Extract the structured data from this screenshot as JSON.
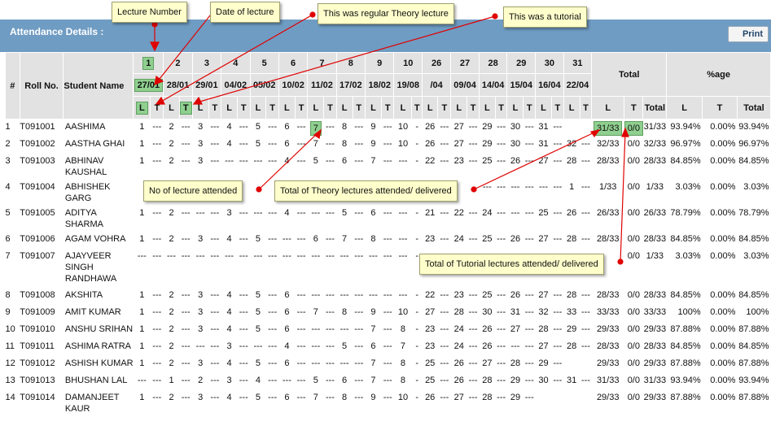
{
  "header": {
    "title": "Attendance Details :",
    "print_label": "Print"
  },
  "columns": {
    "hash": "#",
    "roll": "Roll No.",
    "name": "Student Name",
    "lectures": [
      {
        "no": "1",
        "date": "27/01",
        "type": "L"
      },
      {
        "no": "",
        "date": "",
        "type": "T"
      },
      {
        "no": "2",
        "date": "28/01",
        "type": "L"
      },
      {
        "no": "",
        "date": "",
        "type": "T"
      },
      {
        "no": "3",
        "date": "29/01",
        "type": "L"
      },
      {
        "no": "",
        "date": "",
        "type": "T"
      },
      {
        "no": "4",
        "date": "04/02",
        "type": "L"
      },
      {
        "no": "",
        "date": "",
        "type": "T"
      },
      {
        "no": "5",
        "date": "05/02",
        "type": "L"
      },
      {
        "no": "",
        "date": "",
        "type": "T"
      },
      {
        "no": "6",
        "date": "10/02",
        "type": "L"
      },
      {
        "no": "",
        "date": "",
        "type": "T"
      },
      {
        "no": "7",
        "date": "11/02",
        "type": "L"
      },
      {
        "no": "",
        "date": "",
        "type": "T"
      },
      {
        "no": "8",
        "date": "17/02",
        "type": "L"
      },
      {
        "no": "",
        "date": "",
        "type": "T"
      },
      {
        "no": "9",
        "date": "18/02",
        "type": "L"
      },
      {
        "no": "",
        "date": "",
        "type": "T"
      },
      {
        "no": "10",
        "date": "19/08",
        "type": "L"
      },
      {
        "no": "",
        "date": "",
        "type": "T"
      },
      {
        "no": "26",
        "date": "/04",
        "type": "L"
      },
      {
        "no": "",
        "date": "",
        "type": "T"
      },
      {
        "no": "27",
        "date": "09/04",
        "type": "L"
      },
      {
        "no": "",
        "date": "",
        "type": "T"
      },
      {
        "no": "28",
        "date": "14/04",
        "type": "L"
      },
      {
        "no": "",
        "date": "",
        "type": "T"
      },
      {
        "no": "29",
        "date": "15/04",
        "type": "L"
      },
      {
        "no": "",
        "date": "",
        "type": "T"
      },
      {
        "no": "30",
        "date": "16/04",
        "type": "L"
      },
      {
        "no": "",
        "date": "",
        "type": "T"
      },
      {
        "no": "31",
        "date": "22/04",
        "type": "L"
      },
      {
        "no": "",
        "date": "",
        "type": "T"
      }
    ],
    "total_group": "Total",
    "pct_group": "%age",
    "total_sub": [
      "L",
      "T",
      "Total"
    ],
    "pct_sub": [
      "L",
      "T",
      "Total"
    ]
  },
  "rows": [
    {
      "idx": "1",
      "roll": "T091001",
      "name": "AASHIMA",
      "cells": [
        "1",
        "---",
        "2",
        "---",
        "3",
        "---",
        "4",
        "---",
        "5",
        "---",
        "6",
        "---",
        "7",
        "---",
        "8",
        "---",
        "9",
        "---",
        "10",
        "-",
        "26",
        "---",
        "27",
        "---",
        "29",
        "---",
        "30",
        "---",
        "31",
        "---",
        "",
        ""
      ],
      "tl": "31/33",
      "tt": "0/0",
      "tot": "31/33",
      "pl": "93.94%",
      "pt": "0.00%",
      "ptot": "93.94%"
    },
    {
      "idx": "2",
      "roll": "T091002",
      "name": "AASTHA GHAI",
      "cells": [
        "1",
        "---",
        "2",
        "---",
        "3",
        "---",
        "4",
        "---",
        "5",
        "---",
        "6",
        "---",
        "7",
        "---",
        "8",
        "---",
        "9",
        "---",
        "10",
        "-",
        "26",
        "---",
        "27",
        "---",
        "29",
        "---",
        "30",
        "---",
        "31",
        "---",
        "32",
        "---"
      ],
      "tl": "32/33",
      "tt": "0/0",
      "tot": "32/33",
      "pl": "96.97%",
      "pt": "0.00%",
      "ptot": "96.97%"
    },
    {
      "idx": "3",
      "roll": "T091003",
      "name": "ABHINAV KAUSHAL",
      "cells": [
        "1",
        "---",
        "2",
        "---",
        "3",
        "---",
        "---",
        "---",
        "---",
        "---",
        "4",
        "---",
        "5",
        "---",
        "6",
        "---",
        "7",
        "---",
        "---",
        "-",
        "22",
        "---",
        "23",
        "---",
        "25",
        "---",
        "26",
        "---",
        "27",
        "---",
        "28",
        "---"
      ],
      "tl": "28/33",
      "tt": "0/0",
      "tot": "28/33",
      "pl": "84.85%",
      "pt": "0.00%",
      "ptot": "84.85%"
    },
    {
      "idx": "4",
      "roll": "T091004",
      "name": "ABHISHEK GARG",
      "cells": [
        "",
        "",
        "",
        "",
        "",
        "",
        "",
        "",
        "",
        "",
        "",
        "",
        "",
        "",
        "",
        "",
        "",
        "",
        "",
        "",
        "",
        "",
        "",
        "",
        "---",
        "---",
        "---",
        "---",
        "---",
        "---",
        "1",
        "---"
      ],
      "tl": "1/33",
      "tt": "0/0",
      "tot": "1/33",
      "pl": "3.03%",
      "pt": "0.00%",
      "ptot": "3.03%"
    },
    {
      "idx": "5",
      "roll": "T091005",
      "name": "ADITYA SHARMA",
      "cells": [
        "1",
        "---",
        "2",
        "---",
        "---",
        "---",
        "3",
        "---",
        "---",
        "---",
        "4",
        "---",
        "---",
        "---",
        "5",
        "---",
        "6",
        "---",
        "---",
        "-",
        "21",
        "---",
        "22",
        "---",
        "24",
        "---",
        "---",
        "---",
        "25",
        "---",
        "26",
        "---"
      ],
      "tl": "26/33",
      "tt": "0/0",
      "tot": "26/33",
      "pl": "78.79%",
      "pt": "0.00%",
      "ptot": "78.79%"
    },
    {
      "idx": "6",
      "roll": "T091006",
      "name": "AGAM VOHRA",
      "cells": [
        "1",
        "---",
        "2",
        "---",
        "3",
        "---",
        "4",
        "---",
        "5",
        "---",
        "---",
        "---",
        "6",
        "---",
        "7",
        "---",
        "8",
        "---",
        "---",
        "-",
        "23",
        "---",
        "24",
        "---",
        "25",
        "---",
        "26",
        "---",
        "27",
        "---",
        "28",
        "---"
      ],
      "tl": "28/33",
      "tt": "0/0",
      "tot": "28/33",
      "pl": "84.85%",
      "pt": "0.00%",
      "ptot": "84.85%"
    },
    {
      "idx": "7",
      "roll": "T091007",
      "name": "AJAYVEER SINGH RANDHAWA",
      "cells": [
        "---",
        "---",
        "---",
        "---",
        "---",
        "---",
        "---",
        "---",
        "---",
        "---",
        "---",
        "---",
        "---",
        "---",
        "---",
        "---",
        "---",
        "---",
        "---",
        "-",
        "",
        "",
        "",
        "",
        "",
        "",
        "",
        "",
        "",
        "",
        "",
        ""
      ],
      "tl": "",
      "tt": "0/0",
      "tot": "1/33",
      "pl": "3.03%",
      "pt": "0.00%",
      "ptot": "3.03%"
    },
    {
      "idx": "8",
      "roll": "T091008",
      "name": "AKSHITA",
      "cells": [
        "1",
        "---",
        "2",
        "---",
        "3",
        "---",
        "4",
        "---",
        "5",
        "---",
        "6",
        "---",
        "---",
        "---",
        "---",
        "---",
        "---",
        "---",
        "---",
        "-",
        "22",
        "---",
        "23",
        "---",
        "25",
        "---",
        "26",
        "---",
        "27",
        "---",
        "28",
        "---"
      ],
      "tl": "28/33",
      "tt": "0/0",
      "tot": "28/33",
      "pl": "84.85%",
      "pt": "0.00%",
      "ptot": "84.85%"
    },
    {
      "idx": "9",
      "roll": "T091009",
      "name": "AMIT KUMAR",
      "cells": [
        "1",
        "---",
        "2",
        "---",
        "3",
        "---",
        "4",
        "---",
        "5",
        "---",
        "6",
        "---",
        "7",
        "---",
        "8",
        "---",
        "9",
        "---",
        "10",
        "-",
        "27",
        "---",
        "28",
        "---",
        "30",
        "---",
        "31",
        "---",
        "32",
        "---",
        "33",
        "---"
      ],
      "tl": "33/33",
      "tt": "0/0",
      "tot": "33/33",
      "pl": "100%",
      "pt": "0.00%",
      "ptot": "100%"
    },
    {
      "idx": "10",
      "roll": "T091010",
      "name": "ANSHU SRIHAN",
      "cells": [
        "1",
        "---",
        "2",
        "---",
        "3",
        "---",
        "4",
        "---",
        "5",
        "---",
        "6",
        "---",
        "---",
        "---",
        "---",
        "---",
        "7",
        "---",
        "8",
        "-",
        "23",
        "---",
        "24",
        "---",
        "26",
        "---",
        "27",
        "---",
        "28",
        "---",
        "29",
        "---"
      ],
      "tl": "29/33",
      "tt": "0/0",
      "tot": "29/33",
      "pl": "87.88%",
      "pt": "0.00%",
      "ptot": "87.88%"
    },
    {
      "idx": "11",
      "roll": "T091011",
      "name": "ASHIMA RATRA",
      "cells": [
        "1",
        "---",
        "2",
        "---",
        "---",
        "---",
        "3",
        "---",
        "---",
        "---",
        "4",
        "---",
        "---",
        "---",
        "5",
        "---",
        "6",
        "---",
        "7",
        "-",
        "23",
        "---",
        "24",
        "---",
        "26",
        "---",
        "---",
        "---",
        "27",
        "---",
        "28",
        "---"
      ],
      "tl": "28/33",
      "tt": "0/0",
      "tot": "28/33",
      "pl": "84.85%",
      "pt": "0.00%",
      "ptot": "84.85%"
    },
    {
      "idx": "12",
      "roll": "T091012",
      "name": "ASHISH KUMAR",
      "cells": [
        "1",
        "---",
        "2",
        "---",
        "3",
        "---",
        "4",
        "---",
        "5",
        "---",
        "6",
        "---",
        "---",
        "---",
        "---",
        "---",
        "7",
        "---",
        "8",
        "-",
        "25",
        "---",
        "26",
        "---",
        "27",
        "---",
        "28",
        "---",
        "29",
        "---",
        "",
        ""
      ],
      "tl": "29/33",
      "tt": "0/0",
      "tot": "29/33",
      "pl": "87.88%",
      "pt": "0.00%",
      "ptot": "87.88%"
    },
    {
      "idx": "13",
      "roll": "T091013",
      "name": "BHUSHAN LAL",
      "cells": [
        "---",
        "---",
        "1",
        "---",
        "2",
        "---",
        "3",
        "---",
        "4",
        "---",
        "---",
        "---",
        "5",
        "---",
        "6",
        "---",
        "7",
        "---",
        "8",
        "-",
        "25",
        "---",
        "26",
        "---",
        "28",
        "---",
        "29",
        "---",
        "30",
        "---",
        "31",
        "---"
      ],
      "tl": "31/33",
      "tt": "0/0",
      "tot": "31/33",
      "pl": "93.94%",
      "pt": "0.00%",
      "ptot": "93.94%"
    },
    {
      "idx": "14",
      "roll": "T091014",
      "name": "DAMANJEET KAUR",
      "cells": [
        "1",
        "---",
        "2",
        "---",
        "3",
        "---",
        "4",
        "---",
        "5",
        "---",
        "6",
        "---",
        "7",
        "---",
        "8",
        "---",
        "9",
        "---",
        "10",
        "-",
        "26",
        "---",
        "27",
        "---",
        "28",
        "---",
        "29",
        "---",
        "",
        "",
        " ",
        ""
      ],
      "tl": "29/33",
      "tt": "0/0",
      "tot": "29/33",
      "pl": "87.88%",
      "pt": "0.00%",
      "ptot": "87.88%"
    }
  ],
  "callouts": {
    "lecture_number": "Lecture Number",
    "date": "Date of lecture",
    "theory": "This was regular Theory lecture",
    "tutorial": "This was a tutorial",
    "attended": "No of lecture attended",
    "theory_total": "Total of Theory lectures attended/ delivered",
    "tut_total": "Total of Tutorial lectures attended/ delivered"
  }
}
